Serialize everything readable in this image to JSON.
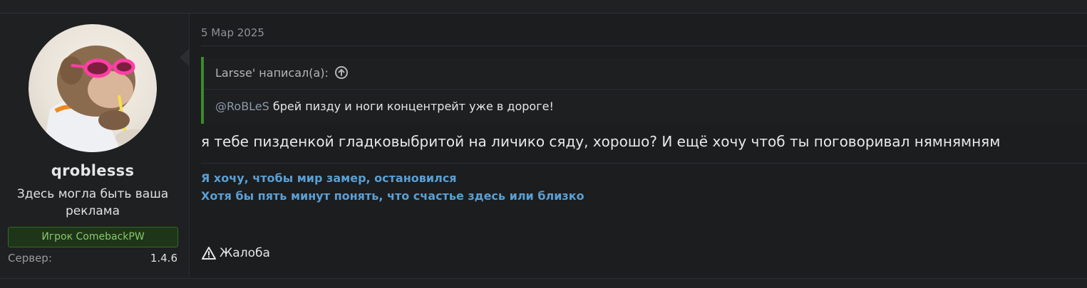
{
  "user": {
    "username": "qroblesss",
    "title": "Здесь могла быть ваша реклама",
    "banner": "Игрок ComebackPW",
    "server_label": "Сервер:",
    "server_value": "1.4.6",
    "avatar_icon": "monkey-with-pink-sunglasses-avatar"
  },
  "post": {
    "date": "5 Мар 2025",
    "quote": {
      "author_line": "Larsse' написал(а):",
      "mention": "@RoBLeS",
      "text": "брей пизду и ноги концентрейт уже в дороге!"
    },
    "body": "я тебе пизденкой гладковыбритой на личико сяду, хорошо? И ещё хочу чтоб ты поговоривал нямнямням",
    "signature": [
      "Я хочу, чтобы мир замер, остановился",
      "Хотя бы пять минут понять, что счастье здесь или близко"
    ],
    "report_label": "Жалоба"
  },
  "colors": {
    "accent_green": "#3c8c2a",
    "banner_text": "#86c96a",
    "signature_blue": "#5a9fd4"
  }
}
